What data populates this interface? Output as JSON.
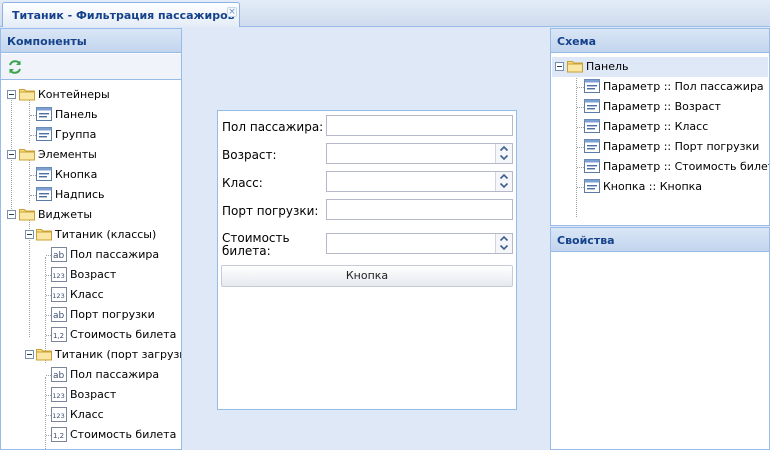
{
  "tab": {
    "title": "Титаник - Фильтрация пассажиров",
    "close": "×"
  },
  "left_panel": {
    "title": "Компоненты",
    "tree": {
      "containers": {
        "label": "Контейнеры",
        "items": [
          "Панель",
          "Группа"
        ]
      },
      "elements": {
        "label": "Элементы",
        "items": [
          "Кнопка",
          "Надпись"
        ]
      },
      "widgets": {
        "label": "Виджеты",
        "group1": {
          "label": "Титаник (классы)",
          "items": [
            "Пол пассажира",
            "Возраст",
            "Класс",
            "Порт погрузки",
            "Стоимость билета"
          ]
        },
        "group2": {
          "label": "Титаник (порт загрузки)",
          "items": [
            "Пол пассажира",
            "Возраст",
            "Класс",
            "Стоимость билета"
          ]
        }
      }
    }
  },
  "form": {
    "fields": [
      {
        "label": "Пол пассажира:",
        "value": ""
      },
      {
        "label": "Возраст:",
        "value": ""
      },
      {
        "label": "Класс:",
        "value": ""
      },
      {
        "label": "Порт погрузки:",
        "value": ""
      },
      {
        "label": "Стоимость билета:",
        "value": ""
      }
    ],
    "button": "Кнопка"
  },
  "schema_panel": {
    "title": "Схема",
    "root": "Панель",
    "items": [
      "Параметр :: Пол пассажира",
      "Параметр :: Возраст",
      "Параметр :: Класс",
      "Параметр :: Порт погрузки",
      "Параметр :: Стоимость билета",
      "Кнопка :: Кнопка"
    ]
  },
  "props_panel": {
    "title": "Свойства"
  },
  "icons": {
    "folder": "folder-icon",
    "component": "form-component-icon",
    "text_field": "text-field-icon",
    "number_field": "number-field-icon",
    "decimal_field": "decimal-field-icon",
    "refresh": "refresh-icon"
  },
  "colors": {
    "header_text": "#15428b",
    "border": "#99bbe8",
    "background": "#dfe8f6",
    "folder": "#f6d36b"
  }
}
